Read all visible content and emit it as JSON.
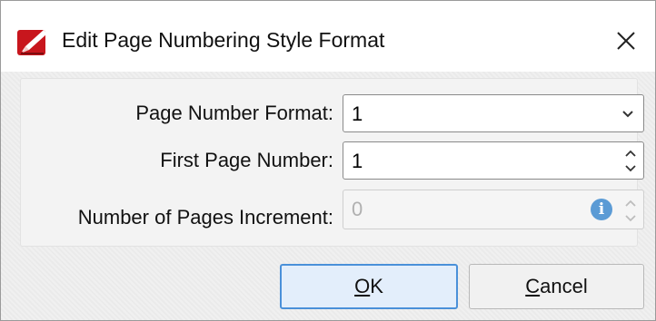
{
  "window": {
    "title": "Edit Page Numbering Style Format",
    "app_icon": "pdf-edit-pen-icon",
    "close_icon": "close-icon"
  },
  "form": {
    "page_number_format": {
      "label": "Page Number Format:",
      "value": "1",
      "icon": "chevron-down-icon"
    },
    "first_page_number": {
      "label": "First Page Number:",
      "value": "1",
      "icon": "spinner-arrows-icon"
    },
    "pages_increment": {
      "label": "Number of Pages Increment:",
      "value": "0",
      "enabled": false,
      "info_icon": "info-icon",
      "info_glyph": "i"
    }
  },
  "buttons": {
    "ok": {
      "label": "OK",
      "mnemonic": "O"
    },
    "cancel": {
      "label": "Cancel",
      "mnemonic": "C"
    }
  },
  "colors": {
    "accent": "#4a90d9",
    "info": "#5b9bd5",
    "icon_red": "#c8161d"
  }
}
